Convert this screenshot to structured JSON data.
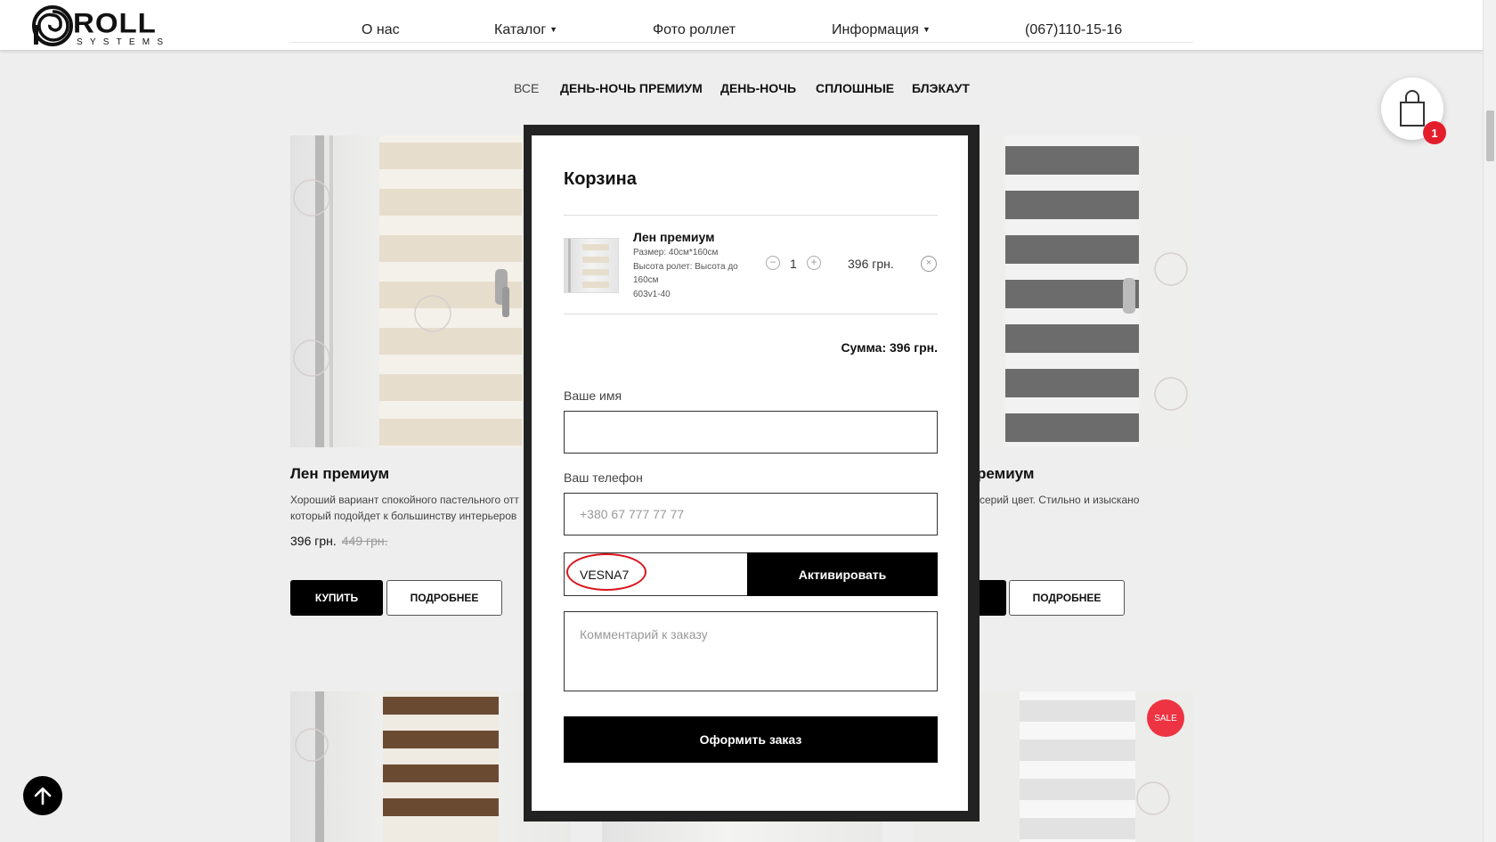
{
  "header": {
    "logo_word": "ROLL",
    "logo_sub": "SYSTEMS",
    "nav": [
      {
        "label": "О нас"
      },
      {
        "label": "Каталог"
      },
      {
        "label": "Фото роллет"
      },
      {
        "label": "Информация"
      },
      {
        "label": "(067)110-15-16"
      }
    ]
  },
  "filters": [
    "ВСЕ",
    "ДЕНЬ-НОЧЬ ПРЕМИУМ",
    "ДЕНЬ-НОЧЬ",
    "СПЛОШНЫЕ",
    "БЛЭКАУТ"
  ],
  "products": {
    "left": {
      "title": "Лен премиум",
      "desc_line1": "Хороший вариант спокойного пастельного отт",
      "desc_line2": "который подойдет к большинству интерьеров",
      "price": "396 грн.",
      "old_price": "449 грн.",
      "buy_label": "КУПИТЬ",
      "more_label": "ПОДРОБНЕЕ"
    },
    "right": {
      "title": "ремиум",
      "desc_line1": "серий цвет. Стильно и изыскано",
      "more_label": "ПОДРОБНЕЕ"
    },
    "sale_badge": "SALE"
  },
  "cart_modal": {
    "title": "Корзина",
    "item": {
      "name": "Лен премиум",
      "size": "Размер: 40см*160см",
      "height_line1": "Высота ролет: Высота до",
      "height_line2": "160см",
      "code": "603v1-40",
      "qty_minus": "−",
      "qty": "1",
      "qty_plus": "+",
      "price": "396 грн.",
      "remove": "×"
    },
    "sum": "Сумма: 396 грн.",
    "name_label": "Ваше имя",
    "name_value": "",
    "phone_label": "Ваш телефон",
    "phone_placeholder": "+380 67 777 77 77",
    "promo_value": "VESNA7",
    "promo_button": "Активировать",
    "comment_placeholder": "Комментарий к заказу",
    "order_button": "Оформить заказ"
  },
  "cart_badge": "1",
  "colors": {
    "accent_red": "#e41d2d",
    "annotation_red": "#d9141c",
    "button_black": "#000000",
    "background": "#eeeeee"
  }
}
